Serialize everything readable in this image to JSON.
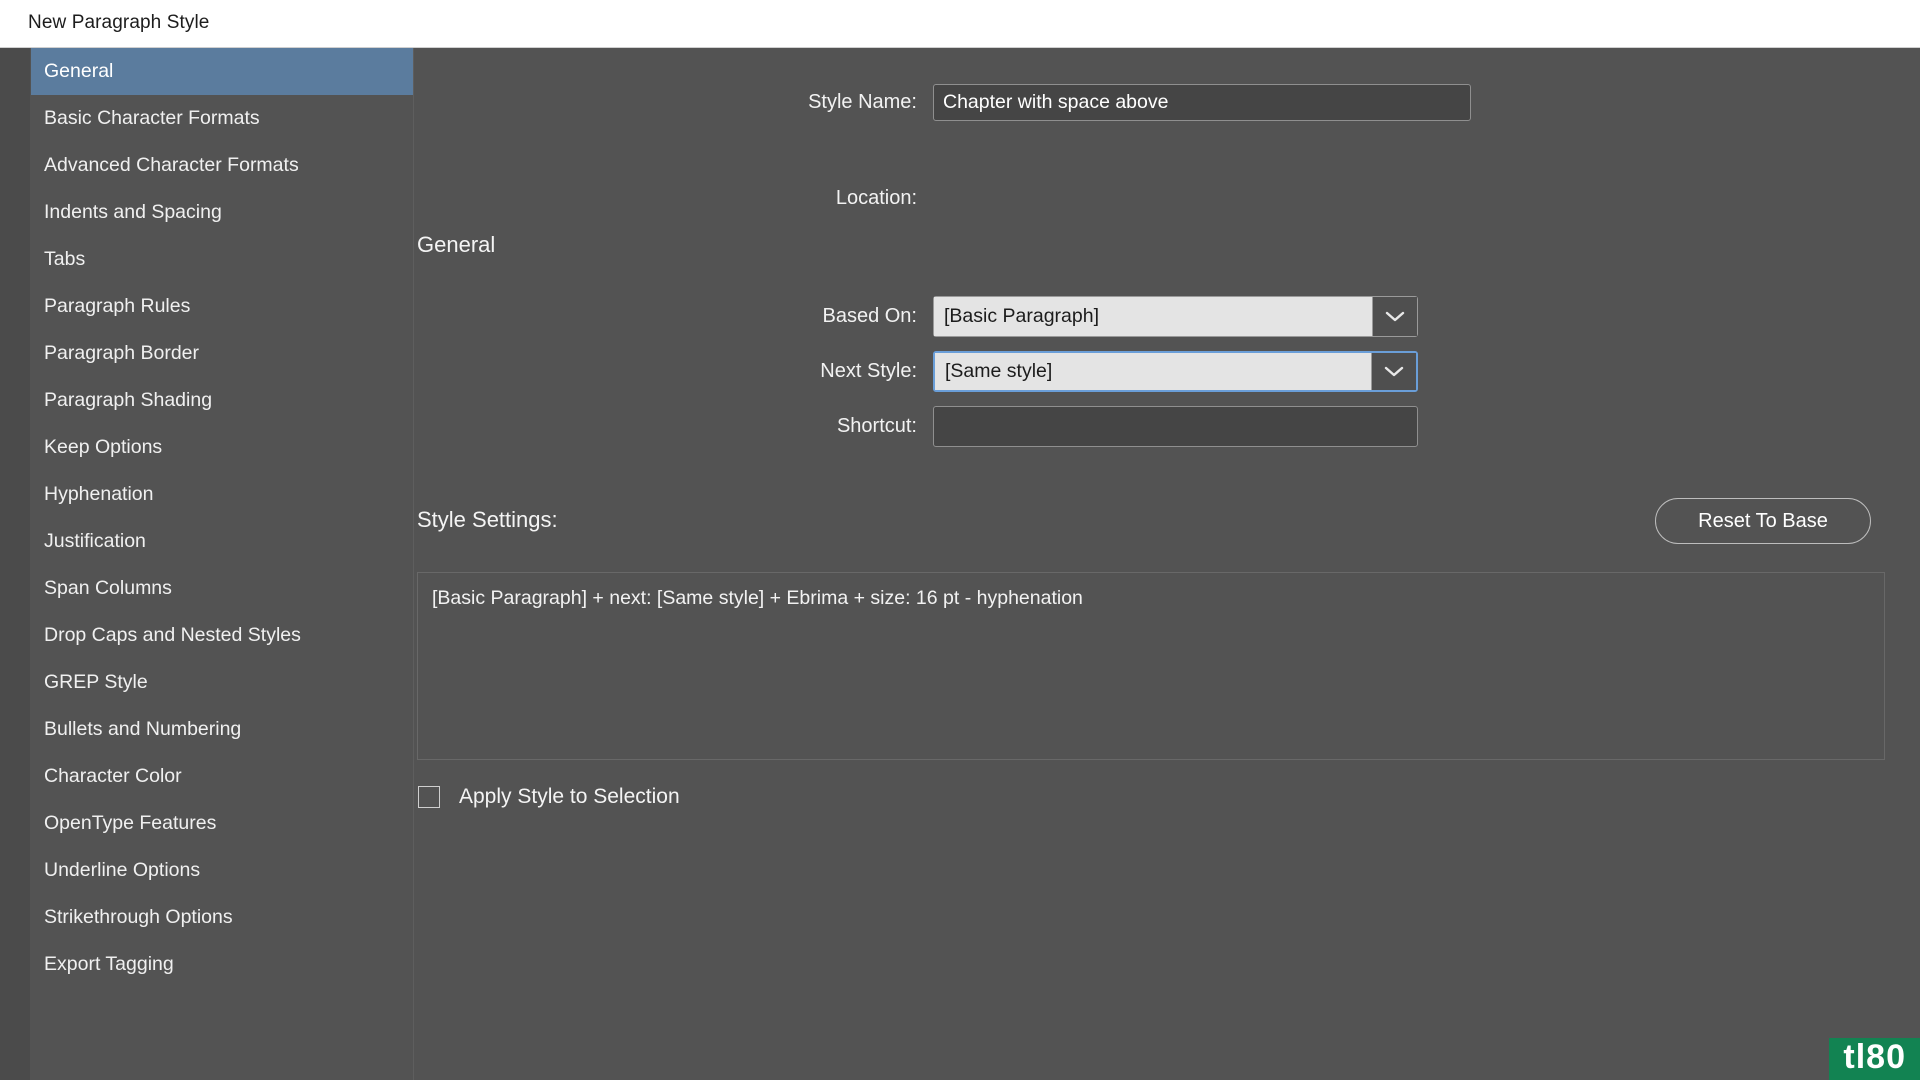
{
  "window": {
    "title": "New Paragraph Style"
  },
  "sidebar": {
    "items": [
      {
        "label": "General",
        "selected": true
      },
      {
        "label": "Basic Character Formats",
        "selected": false
      },
      {
        "label": "Advanced Character Formats",
        "selected": false
      },
      {
        "label": "Indents and Spacing",
        "selected": false
      },
      {
        "label": "Tabs",
        "selected": false
      },
      {
        "label": "Paragraph Rules",
        "selected": false
      },
      {
        "label": "Paragraph Border",
        "selected": false
      },
      {
        "label": "Paragraph Shading",
        "selected": false
      },
      {
        "label": "Keep Options",
        "selected": false
      },
      {
        "label": "Hyphenation",
        "selected": false
      },
      {
        "label": "Justification",
        "selected": false
      },
      {
        "label": "Span Columns",
        "selected": false
      },
      {
        "label": "Drop Caps and Nested Styles",
        "selected": false
      },
      {
        "label": "GREP Style",
        "selected": false
      },
      {
        "label": "Bullets and Numbering",
        "selected": false
      },
      {
        "label": "Character Color",
        "selected": false
      },
      {
        "label": "OpenType Features",
        "selected": false
      },
      {
        "label": "Underline Options",
        "selected": false
      },
      {
        "label": "Strikethrough Options",
        "selected": false
      },
      {
        "label": "Export Tagging",
        "selected": false
      }
    ]
  },
  "main": {
    "style_name": {
      "label": "Style Name:",
      "value": "Chapter with space above",
      "placeholder": ""
    },
    "location": {
      "label": "Location:",
      "value": ""
    },
    "section_heading": "General",
    "based_on": {
      "label": "Based On:",
      "value": "[Basic Paragraph]"
    },
    "next_style": {
      "label": "Next Style:",
      "value": "[Same style]"
    },
    "shortcut": {
      "label": "Shortcut:",
      "value": "",
      "placeholder": ""
    },
    "style_settings": {
      "label": "Style Settings:",
      "text": "[Basic Paragraph] + next: [Same style] + Ebrima + size: 16 pt - hyphenation"
    },
    "reset_to_base_label": "Reset To Base",
    "apply_style": {
      "label": "Apply Style to Selection",
      "checked": false
    }
  },
  "watermark": {
    "text": "tl80"
  },
  "colors": {
    "dialog_background": "#535353",
    "titlebar_background": "#ffffff",
    "selected_nav": "#5b7c9e",
    "combo_background": "#e4e4e4",
    "focus_border": "#6a9ed8",
    "input_background": "#454545",
    "watermark_background": "#128352"
  }
}
